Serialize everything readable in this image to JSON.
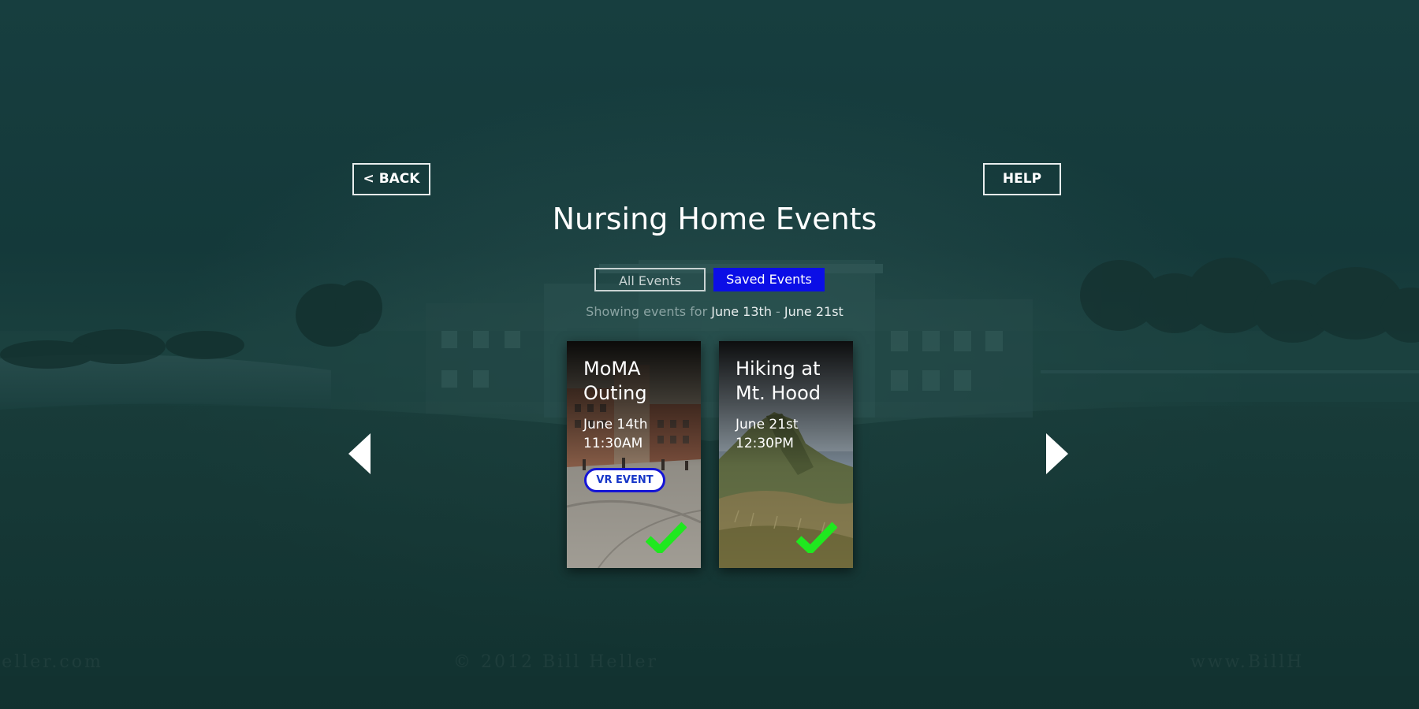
{
  "header": {
    "back_label": "< BACK",
    "help_label": "HELP",
    "title": "Nursing Home Events"
  },
  "tabs": [
    {
      "label": "All Events",
      "selected": false
    },
    {
      "label": "Saved Events",
      "selected": true
    }
  ],
  "range": {
    "prefix": "Showing events for",
    "start": "June 13th",
    "separator": "-",
    "end": "June 21st"
  },
  "events": [
    {
      "title": "MoMA Outing",
      "date": "June 14th",
      "time": "11:30AM",
      "badge": "VR EVENT",
      "saved": true
    },
    {
      "title": "Hiking at Mt. Hood",
      "date": "June 21st",
      "time": "12:30PM",
      "saved": true
    }
  ],
  "watermark": {
    "left": "Heller.com",
    "center": "© 2012 Bill Heller",
    "right": "www.BillH"
  },
  "colors": {
    "background": "#15383a",
    "selected_tab": "#0b0ee6",
    "check": "#1fe81f",
    "badge_border": "#1414d6"
  },
  "icons": {
    "prev": "chevron-left-icon",
    "next": "chevron-right-icon",
    "saved": "checkmark-icon"
  }
}
